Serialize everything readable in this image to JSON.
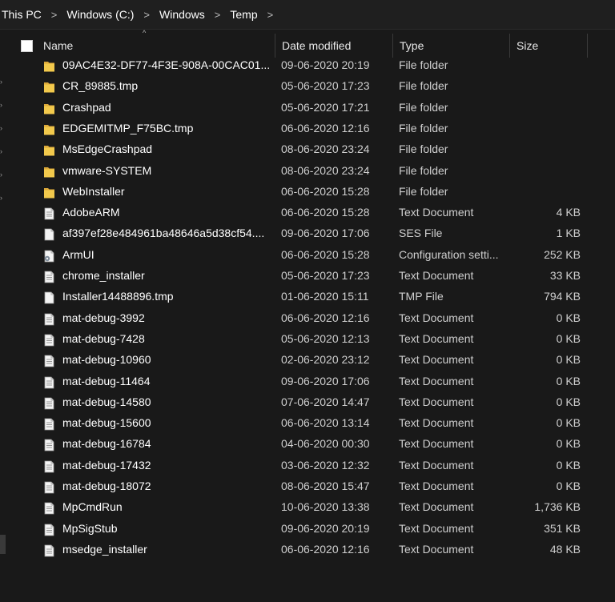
{
  "breadcrumb": {
    "items": [
      "This PC",
      "Windows (C:)",
      "Windows",
      "Temp"
    ],
    "separator": ">"
  },
  "columns": {
    "name": "Name",
    "date": "Date modified",
    "type": "Type",
    "size": "Size"
  },
  "colors": {
    "background": "#191919",
    "folder": "#f2c94c",
    "text": "#ffffff",
    "muted": "#cfcfcf"
  },
  "files": [
    {
      "name": "09AC4E32-DF77-4F3E-908A-00CAC01...",
      "date": "09-06-2020 20:19",
      "type": "File folder",
      "size": "",
      "icon": "folder-icon"
    },
    {
      "name": "CR_89885.tmp",
      "date": "05-06-2020 17:23",
      "type": "File folder",
      "size": "",
      "icon": "folder-icon"
    },
    {
      "name": "Crashpad",
      "date": "05-06-2020 17:21",
      "type": "File folder",
      "size": "",
      "icon": "folder-icon"
    },
    {
      "name": "EDGEMITMP_F75BC.tmp",
      "date": "06-06-2020 12:16",
      "type": "File folder",
      "size": "",
      "icon": "folder-icon"
    },
    {
      "name": "MsEdgeCrashpad",
      "date": "08-06-2020 23:24",
      "type": "File folder",
      "size": "",
      "icon": "folder-icon"
    },
    {
      "name": "vmware-SYSTEM",
      "date": "08-06-2020 23:24",
      "type": "File folder",
      "size": "",
      "icon": "folder-icon"
    },
    {
      "name": "WebInstaller",
      "date": "06-06-2020 15:28",
      "type": "File folder",
      "size": "",
      "icon": "folder-icon"
    },
    {
      "name": "AdobeARM",
      "date": "06-06-2020 15:28",
      "type": "Text Document",
      "size": "4 KB",
      "icon": "text-file-icon"
    },
    {
      "name": "af397ef28e484961ba48646a5d38cf54....",
      "date": "09-06-2020 17:06",
      "type": "SES File",
      "size": "1 KB",
      "icon": "blank-file-icon"
    },
    {
      "name": "ArmUI",
      "date": "06-06-2020 15:28",
      "type": "Configuration setti...",
      "size": "252 KB",
      "icon": "config-file-icon"
    },
    {
      "name": "chrome_installer",
      "date": "05-06-2020 17:23",
      "type": "Text Document",
      "size": "33 KB",
      "icon": "text-file-icon"
    },
    {
      "name": "Installer14488896.tmp",
      "date": "01-06-2020 15:11",
      "type": "TMP File",
      "size": "794 KB",
      "icon": "blank-file-icon"
    },
    {
      "name": "mat-debug-3992",
      "date": "06-06-2020 12:16",
      "type": "Text Document",
      "size": "0 KB",
      "icon": "text-file-icon"
    },
    {
      "name": "mat-debug-7428",
      "date": "05-06-2020 12:13",
      "type": "Text Document",
      "size": "0 KB",
      "icon": "text-file-icon"
    },
    {
      "name": "mat-debug-10960",
      "date": "02-06-2020 23:12",
      "type": "Text Document",
      "size": "0 KB",
      "icon": "text-file-icon"
    },
    {
      "name": "mat-debug-11464",
      "date": "09-06-2020 17:06",
      "type": "Text Document",
      "size": "0 KB",
      "icon": "text-file-icon"
    },
    {
      "name": "mat-debug-14580",
      "date": "07-06-2020 14:47",
      "type": "Text Document",
      "size": "0 KB",
      "icon": "text-file-icon"
    },
    {
      "name": "mat-debug-15600",
      "date": "06-06-2020 13:14",
      "type": "Text Document",
      "size": "0 KB",
      "icon": "text-file-icon"
    },
    {
      "name": "mat-debug-16784",
      "date": "04-06-2020 00:30",
      "type": "Text Document",
      "size": "0 KB",
      "icon": "text-file-icon"
    },
    {
      "name": "mat-debug-17432",
      "date": "03-06-2020 12:32",
      "type": "Text Document",
      "size": "0 KB",
      "icon": "text-file-icon"
    },
    {
      "name": "mat-debug-18072",
      "date": "08-06-2020 15:47",
      "type": "Text Document",
      "size": "0 KB",
      "icon": "text-file-icon"
    },
    {
      "name": "MpCmdRun",
      "date": "10-06-2020 13:38",
      "type": "Text Document",
      "size": "1,736 KB",
      "icon": "text-file-icon"
    },
    {
      "name": "MpSigStub",
      "date": "09-06-2020 20:19",
      "type": "Text Document",
      "size": "351 KB",
      "icon": "text-file-icon"
    },
    {
      "name": "msedge_installer",
      "date": "06-06-2020 12:16",
      "type": "Text Document",
      "size": "48 KB",
      "icon": "text-file-icon"
    }
  ]
}
